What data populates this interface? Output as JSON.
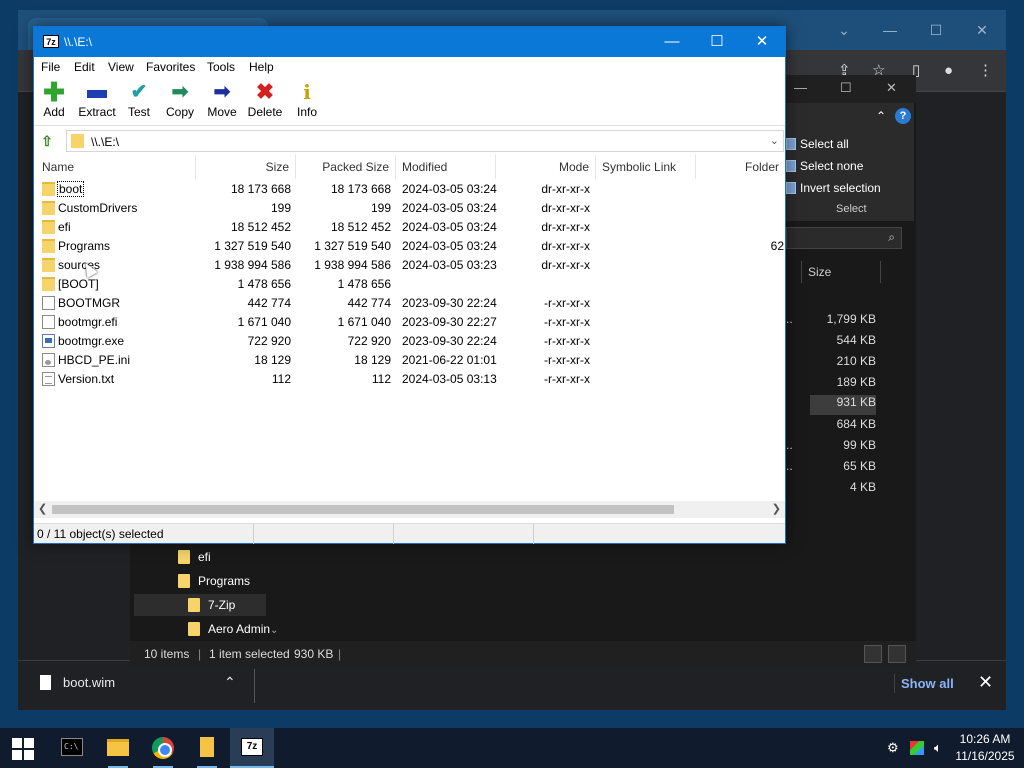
{
  "browser": {
    "download": {
      "filename": "boot.wim",
      "show_all": "Show all"
    }
  },
  "explorer": {
    "ribbon": {
      "select_all": "Select all",
      "select_none": "Select none",
      "invert_selection": "Invert selection",
      "group_label": "Select"
    },
    "column_size": "Size",
    "sizes": [
      "1,799 KB",
      "544 KB",
      "210 KB",
      "189 KB",
      "931 KB",
      "684 KB",
      "99 KB",
      "65 KB",
      "4 KB"
    ],
    "nav": [
      "efi",
      "Programs",
      "7-Zip",
      "Aero Admin"
    ],
    "status": {
      "items": "10 items",
      "selected": "1 item selected",
      "size": "930 KB"
    }
  },
  "zip": {
    "title": "\\\\.\\E:\\",
    "menu": [
      "File",
      "Edit",
      "View",
      "Favorites",
      "Tools",
      "Help"
    ],
    "toolbar": [
      "Add",
      "Extract",
      "Test",
      "Copy",
      "Move",
      "Delete",
      "Info"
    ],
    "address": "\\\\.\\E:\\",
    "columns": [
      "Name",
      "Size",
      "Packed Size",
      "Modified",
      "Mode",
      "Symbolic Link",
      "Folder"
    ],
    "rows": [
      {
        "icon": "folder",
        "name": "boot",
        "size": "18 173 668",
        "packed": "18 173 668",
        "modified": "2024-03-05 03:24",
        "mode": "dr-xr-xr-x",
        "folders": ""
      },
      {
        "icon": "folder",
        "name": "CustomDrivers",
        "size": "199",
        "packed": "199",
        "modified": "2024-03-05 03:24",
        "mode": "dr-xr-xr-x",
        "folders": ""
      },
      {
        "icon": "folder",
        "name": "efi",
        "size": "18 512 452",
        "packed": "18 512 452",
        "modified": "2024-03-05 03:24",
        "mode": "dr-xr-xr-x",
        "folders": ""
      },
      {
        "icon": "folder",
        "name": "Programs",
        "size": "1 327 519 540",
        "packed": "1 327 519 540",
        "modified": "2024-03-05 03:24",
        "mode": "dr-xr-xr-x",
        "folders": "62"
      },
      {
        "icon": "folder",
        "name": "sources",
        "size": "1 938 994 586",
        "packed": "1 938 994 586",
        "modified": "2024-03-05 03:23",
        "mode": "dr-xr-xr-x",
        "folders": ""
      },
      {
        "icon": "folder",
        "name": "[BOOT]",
        "size": "1 478 656",
        "packed": "1 478 656",
        "modified": "",
        "mode": "",
        "folders": ""
      },
      {
        "icon": "file",
        "name": "BOOTMGR",
        "size": "442 774",
        "packed": "442 774",
        "modified": "2023-09-30 22:24",
        "mode": "-r-xr-xr-x",
        "folders": ""
      },
      {
        "icon": "file",
        "name": "bootmgr.efi",
        "size": "1 671 040",
        "packed": "1 671 040",
        "modified": "2023-09-30 22:27",
        "mode": "-r-xr-xr-x",
        "folders": ""
      },
      {
        "icon": "exe",
        "name": "bootmgr.exe",
        "size": "722 920",
        "packed": "722 920",
        "modified": "2023-09-30 22:24",
        "mode": "-r-xr-xr-x",
        "folders": ""
      },
      {
        "icon": "ini",
        "name": "HBCD_PE.ini",
        "size": "18 129",
        "packed": "18 129",
        "modified": "2021-06-22 01:01",
        "mode": "-r-xr-xr-x",
        "folders": ""
      },
      {
        "icon": "txt",
        "name": "Version.txt",
        "size": "112",
        "packed": "112",
        "modified": "2024-03-05 03:13",
        "mode": "-r-xr-xr-x",
        "folders": ""
      }
    ],
    "status": "0 / 11 object(s) selected"
  },
  "taskbar": {
    "time": "10:26 AM",
    "date": "11/16/2025"
  }
}
